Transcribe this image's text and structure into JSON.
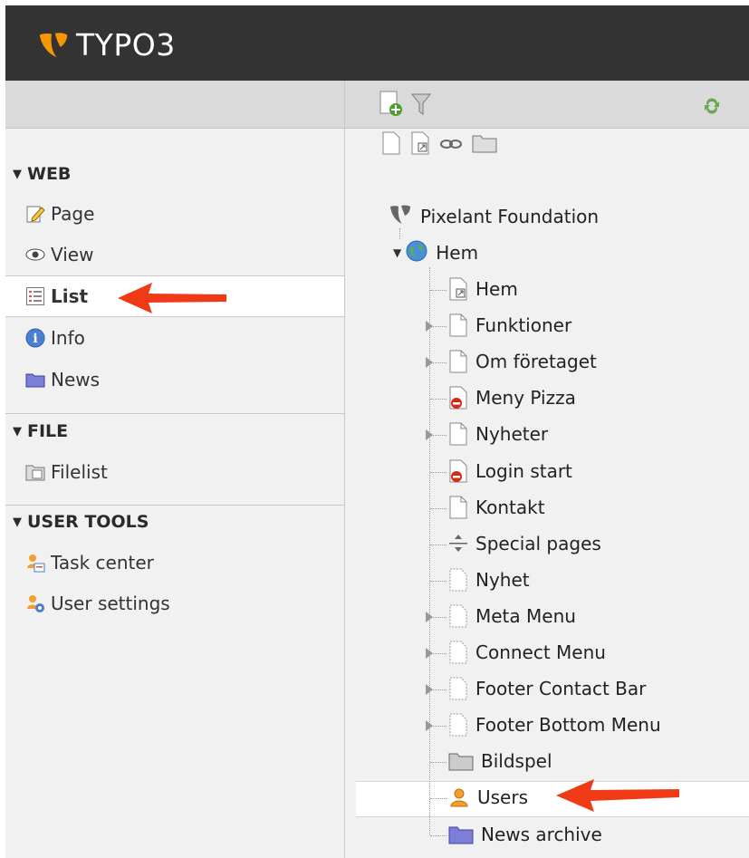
{
  "header": {
    "logo_text": "TYPO3"
  },
  "left_menu": {
    "groups": [
      {
        "label": "WEB",
        "items": [
          {
            "label": "Page",
            "icon": "page-edit-icon"
          },
          {
            "label": "View",
            "icon": "eye-icon"
          },
          {
            "label": "List",
            "icon": "list-icon",
            "active": true
          },
          {
            "label": "Info",
            "icon": "info-icon"
          },
          {
            "label": "News",
            "icon": "folder-icon"
          }
        ]
      },
      {
        "label": "FILE",
        "items": [
          {
            "label": "Filelist",
            "icon": "filelist-icon"
          }
        ]
      },
      {
        "label": "USER TOOLS",
        "items": [
          {
            "label": "Task center",
            "icon": "task-center-icon"
          },
          {
            "label": "User settings",
            "icon": "user-settings-icon"
          }
        ]
      }
    ]
  },
  "page_tree": {
    "root": "Pixelant Foundation",
    "home": "Hem",
    "children": [
      "Hem",
      "Funktioner",
      "Om företaget",
      "Meny Pizza",
      "Nyheter",
      "Login start",
      "Kontakt",
      "Special pages",
      "Nyhet",
      "Meta Menu",
      "Connect Menu",
      "Footer Contact Bar",
      "Footer Bottom Menu",
      "Bildspel",
      "Users",
      "News archive"
    ]
  },
  "colors": {
    "header_bg": "#333333",
    "accent_orange": "#f49700",
    "arrow_red": "#f03a17",
    "refresh_green": "#6aa84f"
  }
}
